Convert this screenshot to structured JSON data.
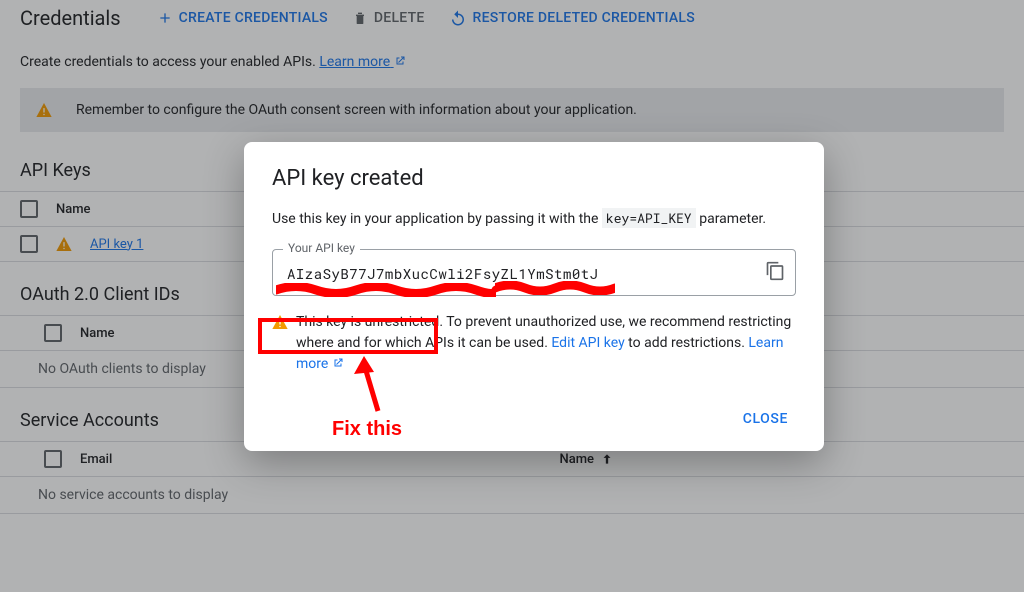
{
  "toolbar": {
    "title": "Credentials",
    "create": "CREATE CREDENTIALS",
    "delete": "DELETE",
    "restore": "RESTORE DELETED CREDENTIALS"
  },
  "intro": {
    "text": "Create credentials to access your enabled APIs. ",
    "learn": "Learn more"
  },
  "banner": {
    "text": "Remember to configure the OAuth consent screen with information about your application."
  },
  "api_keys": {
    "title": "API Keys",
    "col_name": "Name",
    "row1": "API key 1"
  },
  "oauth": {
    "title": "OAuth 2.0 Client IDs",
    "col_name": "Name",
    "empty": "No OAuth clients to display"
  },
  "service": {
    "title": "Service Accounts",
    "col_email": "Email",
    "col_name": "Name",
    "empty": "No service accounts to display"
  },
  "dialog": {
    "title": "API key created",
    "desc_a": "Use this key in your application by passing it with the ",
    "desc_code": "key=API_KEY",
    "desc_b": " parameter.",
    "field_label": "Your API key",
    "key_value": "AIzaSyB77J7mbXucCwli2FsyZL1YmStm0tJ",
    "warn_a": "This key is unrestricted.",
    "warn_b": " To prevent unauthorized use, we recommend restricting where and for which APIs it can be used. ",
    "edit_link": "Edit API key",
    "warn_c": " to add restrictions. ",
    "learn": "Learn more",
    "close": "CLOSE"
  },
  "annotation": {
    "fix": "Fix this"
  }
}
